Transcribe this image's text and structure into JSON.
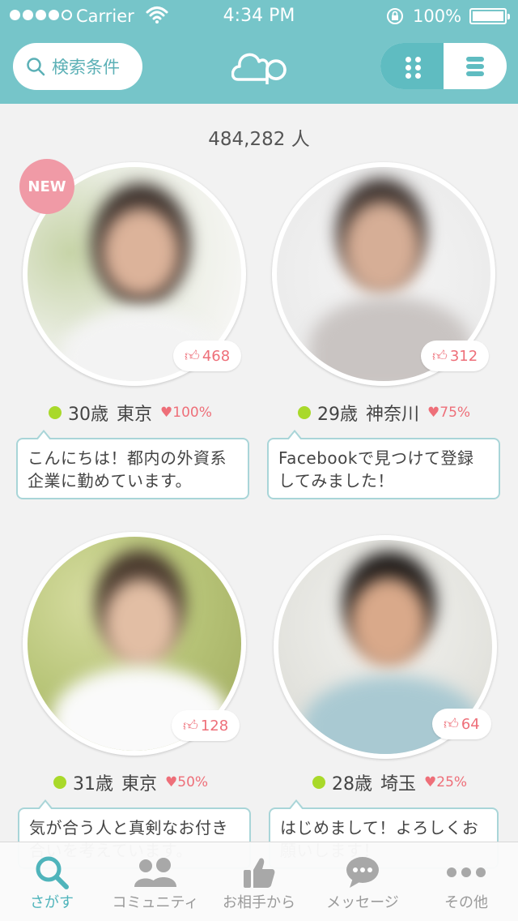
{
  "status_bar": {
    "carrier": "Carrier",
    "time": "4:34 PM",
    "battery": "100%",
    "signal_icon": "signal-dots-icon",
    "wifi_icon": "wifi-icon",
    "lock_icon": "rotation-lock-icon"
  },
  "nav": {
    "search_label": "検索条件",
    "logo_icon": "pairs-logo-icon",
    "view_modes": [
      "grid",
      "list"
    ],
    "active_view": "grid"
  },
  "results": {
    "count": "484,282 人"
  },
  "profiles": [
    {
      "is_new": true,
      "new_label": "NEW",
      "likes": "468",
      "age": "30歳",
      "location": "東京",
      "match": "100%",
      "message": "こんにちは！都内の外資系企業に勤めています。",
      "online": true
    },
    {
      "is_new": false,
      "likes": "312",
      "age": "29歳",
      "location": "神奈川",
      "match": "75%",
      "message": "Facebookで見つけて登録してみました！",
      "online": true
    },
    {
      "is_new": false,
      "likes": "128",
      "age": "31歳",
      "location": "東京",
      "match": "50%",
      "message": "気が合う人と真剣なお付き合いを考えています。",
      "online": true
    },
    {
      "is_new": false,
      "likes": "64",
      "age": "28歳",
      "location": "埼玉",
      "match": "25%",
      "message": "はじめまして！よろしくお願いします！",
      "online": true
    }
  ],
  "tabbar": {
    "items": [
      {
        "label": "さがす",
        "icon": "search-icon",
        "active": true
      },
      {
        "label": "コミュニティ",
        "icon": "people-icon",
        "active": false
      },
      {
        "label": "お相手から",
        "icon": "thumbs-up-icon",
        "active": false
      },
      {
        "label": "メッセージ",
        "icon": "speech-bubble-icon",
        "active": false
      },
      {
        "label": "その他",
        "icon": "more-dots-icon",
        "active": false
      }
    ]
  },
  "colors": {
    "header": "#76c5c9",
    "accent": "#4fb4bb",
    "like": "#ee6f79",
    "online": "#a9d92a",
    "new_badge": "#f09aa6"
  }
}
